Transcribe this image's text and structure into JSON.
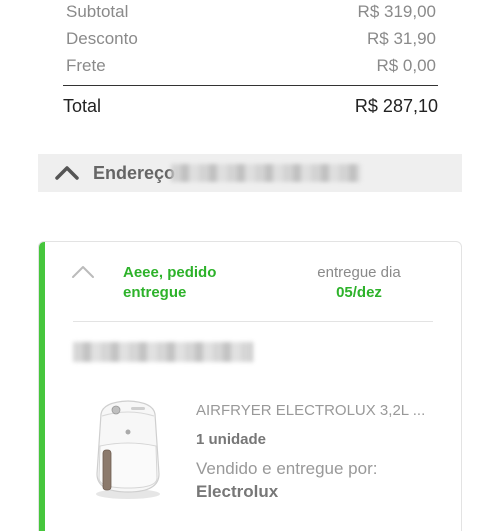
{
  "summary": {
    "rows": [
      {
        "label": "Subtotal",
        "value": "R$ 319,00"
      },
      {
        "label": "Desconto",
        "value": "R$ 31,90"
      },
      {
        "label": "Frete",
        "value": "R$ 0,00"
      }
    ],
    "total_label": "Total",
    "total_value": "R$ 287,10"
  },
  "address": {
    "label": "Endereço",
    "icon": "chevron-up-icon"
  },
  "order": {
    "status_line1": "Aeee, pedido",
    "status_line2": "entregue",
    "delivery_label": "entregue dia",
    "delivery_date": "05/dez",
    "accent_color": "#46c63c",
    "product": {
      "name": "AIRFRYER ELECTROLUX 3,2L ...",
      "quantity": "1 unidade",
      "seller_label": "Vendido e entregue por:",
      "seller": "Electrolux"
    }
  }
}
